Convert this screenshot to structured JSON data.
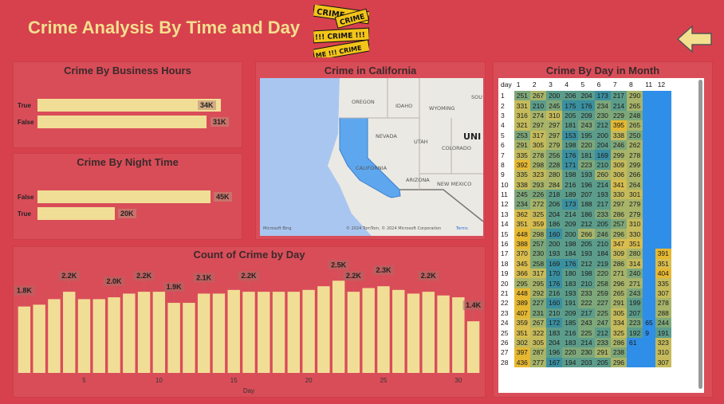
{
  "header": {
    "title": "Crime Analysis By Time and Day",
    "logo_words": [
      "CRIME",
      "CRIME",
      "!!! CRIME !!!",
      "ME !!! CRIME"
    ]
  },
  "icons": {
    "back": "left-arrow-icon",
    "logo": "crime-tape-logo"
  },
  "colors": {
    "background": "#d7414e",
    "panel": "#d94d59",
    "bar": "#f1de96",
    "title": "#f3df8e"
  },
  "business": {
    "title": "Crime By Business Hours",
    "rows": [
      {
        "label": "True",
        "value": 34000,
        "display": "34K"
      },
      {
        "label": "False",
        "value": 31000,
        "display": "31K"
      }
    ]
  },
  "night": {
    "title": "Crime By Night Time",
    "rows": [
      {
        "label": "False",
        "value": 45000,
        "display": "45K"
      },
      {
        "label": "True",
        "value": 20000,
        "display": "20K"
      }
    ]
  },
  "map": {
    "title": "Crime in California",
    "labels": [
      "OREGON",
      "IDAHO",
      "WYOMING",
      "NEVADA",
      "UTAH",
      "COLORADO",
      "CALIFORNIA",
      "ARIZONA",
      "NEW MEXICO",
      "SOU",
      "UNI"
    ],
    "attribution": "Microsoft Bing",
    "copyright": "© 2024 TomTom, © 2024 Microsoft Corporation",
    "terms": "Terms"
  },
  "daygrid": {
    "title": "Crime By Day in Month",
    "header_label": "day",
    "columns": [
      "1",
      "2",
      "3",
      "4",
      "5",
      "6",
      "7",
      "8",
      "11",
      "12"
    ],
    "rows": [
      {
        "day": "1",
        "v": [
          251,
          267,
          200,
          206,
          204,
          173,
          217,
          290,
          null,
          null
        ]
      },
      {
        "day": "2",
        "v": [
          331,
          210,
          245,
          175,
          176,
          234,
          214,
          265,
          null,
          null
        ]
      },
      {
        "day": "3",
        "v": [
          316,
          274,
          310,
          205,
          209,
          230,
          229,
          248,
          null,
          null
        ]
      },
      {
        "day": "4",
        "v": [
          321,
          297,
          297,
          181,
          243,
          212,
          395,
          265,
          null,
          null
        ]
      },
      {
        "day": "5",
        "v": [
          253,
          317,
          297,
          153,
          195,
          200,
          338,
          250,
          null,
          null
        ]
      },
      {
        "day": "6",
        "v": [
          291,
          305,
          279,
          198,
          220,
          204,
          246,
          262,
          null,
          null
        ]
      },
      {
        "day": "7",
        "v": [
          335,
          278,
          256,
          176,
          181,
          169,
          299,
          278,
          null,
          null
        ]
      },
      {
        "day": "8",
        "v": [
          392,
          298,
          228,
          171,
          223,
          210,
          309,
          299,
          null,
          null
        ]
      },
      {
        "day": "9",
        "v": [
          335,
          323,
          280,
          198,
          193,
          260,
          306,
          266,
          null,
          null
        ]
      },
      {
        "day": "10",
        "v": [
          338,
          293,
          284,
          216,
          196,
          214,
          341,
          264,
          null,
          null
        ]
      },
      {
        "day": "11",
        "v": [
          245,
          226,
          218,
          189,
          207,
          193,
          330,
          301,
          null,
          null
        ]
      },
      {
        "day": "12",
        "v": [
          234,
          272,
          206,
          173,
          188,
          217,
          297,
          279,
          null,
          null
        ]
      },
      {
        "day": "13",
        "v": [
          362,
          325,
          204,
          214,
          186,
          233,
          286,
          279,
          null,
          null
        ]
      },
      {
        "day": "14",
        "v": [
          351,
          359,
          186,
          209,
          212,
          205,
          257,
          310,
          null,
          null
        ]
      },
      {
        "day": "15",
        "v": [
          448,
          298,
          160,
          200,
          266,
          246,
          296,
          330,
          null,
          null
        ]
      },
      {
        "day": "16",
        "v": [
          388,
          257,
          200,
          198,
          205,
          210,
          347,
          351,
          null,
          null
        ]
      },
      {
        "day": "17",
        "v": [
          370,
          230,
          193,
          184,
          193,
          184,
          309,
          280,
          null,
          391
        ]
      },
      {
        "day": "18",
        "v": [
          345,
          258,
          169,
          176,
          212,
          219,
          286,
          314,
          null,
          351
        ]
      },
      {
        "day": "19",
        "v": [
          366,
          317,
          170,
          180,
          198,
          220,
          271,
          240,
          null,
          404
        ]
      },
      {
        "day": "20",
        "v": [
          295,
          295,
          176,
          183,
          210,
          258,
          296,
          271,
          null,
          335
        ]
      },
      {
        "day": "21",
        "v": [
          448,
          292,
          216,
          193,
          233,
          259,
          265,
          243,
          null,
          307
        ]
      },
      {
        "day": "22",
        "v": [
          389,
          227,
          160,
          191,
          222,
          227,
          291,
          199,
          null,
          278
        ]
      },
      {
        "day": "23",
        "v": [
          407,
          231,
          210,
          209,
          217,
          225,
          305,
          207,
          null,
          288
        ]
      },
      {
        "day": "24",
        "v": [
          359,
          267,
          172,
          185,
          243,
          247,
          334,
          223,
          65,
          244
        ]
      },
      {
        "day": "25",
        "v": [
          351,
          322,
          183,
          216,
          225,
          212,
          325,
          192,
          9,
          191
        ]
      },
      {
        "day": "26",
        "v": [
          302,
          305,
          204,
          183,
          214,
          233,
          286,
          61,
          null,
          323
        ]
      },
      {
        "day": "27",
        "v": [
          397,
          287,
          196,
          220,
          230,
          291,
          238,
          null,
          null,
          310
        ]
      },
      {
        "day": "28",
        "v": [
          436,
          277,
          167,
          194,
          203,
          205,
          296,
          null,
          null,
          307
        ]
      }
    ]
  },
  "count_by_day": {
    "title": "Count of Crime by Day"
  },
  "chart_data": {
    "type": "bar",
    "title": "Count of Crime by Day",
    "xlabel": "Day",
    "x": [
      1,
      2,
      3,
      4,
      5,
      6,
      7,
      8,
      9,
      10,
      11,
      12,
      13,
      14,
      15,
      16,
      17,
      18,
      19,
      20,
      21,
      22,
      23,
      24,
      25,
      26,
      27,
      28,
      29,
      30,
      31
    ],
    "values": [
      1800,
      1850,
      2000,
      2200,
      2000,
      2000,
      2050,
      2150,
      2200,
      2200,
      1900,
      1900,
      2150,
      2150,
      2250,
      2200,
      2200,
      2200,
      2200,
      2250,
      2350,
      2500,
      2200,
      2300,
      2350,
      2250,
      2150,
      2200,
      2100,
      2050,
      1400
    ],
    "data_labels": {
      "1": "1.8K",
      "4": "2.2K",
      "7": "2.0K",
      "9": "2.2K",
      "11": "1.9K",
      "13": "2.1K",
      "16": "2.2K",
      "22": "2.5K",
      "23": "2.2K",
      "25": "2.3K",
      "28": "2.2K",
      "31": "1.4K"
    },
    "xticks": [
      5,
      10,
      15,
      20,
      25,
      30
    ],
    "ylim": [
      0,
      2700
    ],
    "color": "#f1de96"
  }
}
